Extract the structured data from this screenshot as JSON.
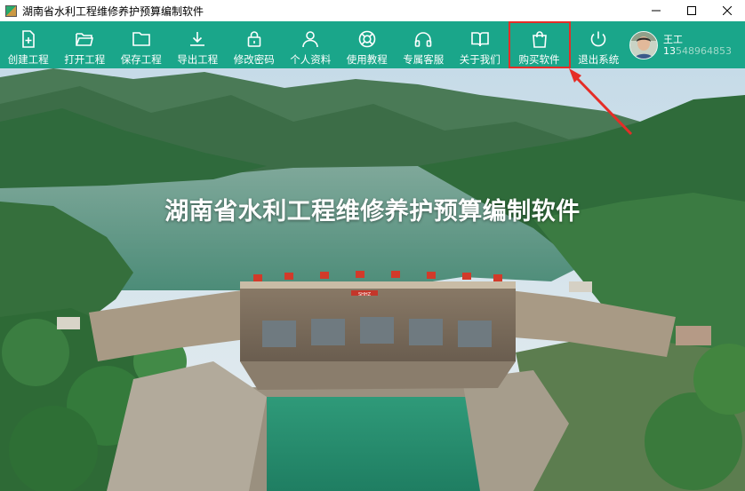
{
  "window": {
    "title": "湖南省水利工程维修养护预算编制软件",
    "controls": [
      "minimize-icon",
      "maximize-icon",
      "close-icon"
    ]
  },
  "toolbar": {
    "items": [
      {
        "id": "create-project",
        "label": "创建工程",
        "icon": "file-plus-icon"
      },
      {
        "id": "open-project",
        "label": "打开工程",
        "icon": "folder-open-icon"
      },
      {
        "id": "save-project",
        "label": "保存工程",
        "icon": "folder-icon"
      },
      {
        "id": "export-project",
        "label": "导出工程",
        "icon": "download-icon"
      },
      {
        "id": "change-password",
        "label": "修改密码",
        "icon": "lock-icon"
      },
      {
        "id": "profile",
        "label": "个人资料",
        "icon": "user-icon"
      },
      {
        "id": "tutorial",
        "label": "使用教程",
        "icon": "lifebuoy-icon"
      },
      {
        "id": "support",
        "label": "专属客服",
        "icon": "headphones-icon"
      },
      {
        "id": "about",
        "label": "关于我们",
        "icon": "book-icon"
      },
      {
        "id": "buy",
        "label": "购买软件",
        "icon": "shopping-bag-icon",
        "highlighted": true
      },
      {
        "id": "logout",
        "label": "退出系统",
        "icon": "power-icon"
      }
    ],
    "background": "#1aa68a",
    "highlight_color": "#e52d27"
  },
  "user": {
    "name": "王工",
    "phone_prefix": "13",
    "phone_masked": "548964853"
  },
  "hero": {
    "title": "湖南省水利工程维修养护预算编制软件",
    "dam_sign": "SHHZ"
  }
}
